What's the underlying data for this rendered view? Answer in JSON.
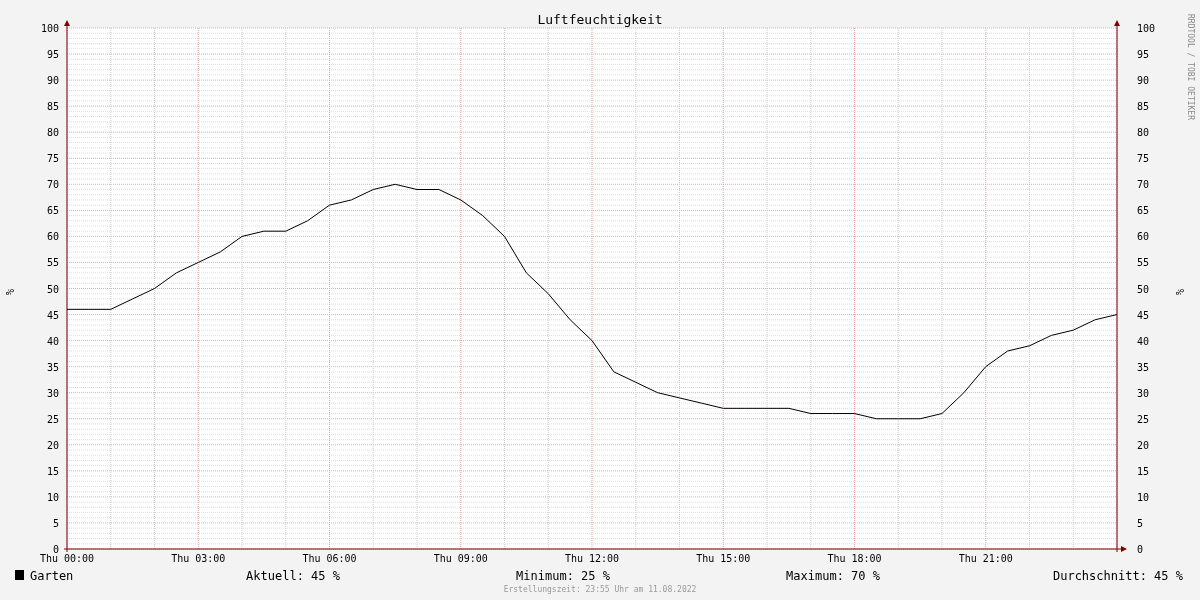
{
  "chart": {
    "watermark": "RRDTOOL / TOBI OETIKER",
    "chart_data": {
      "type": "line",
      "title": "Luftfeuchtigkeit",
      "ylabel": "%",
      "categories": [
        "Thu 00:00",
        null,
        null,
        null,
        null,
        null,
        "Thu 03:00",
        null,
        null,
        null,
        null,
        null,
        "Thu 06:00",
        null,
        null,
        null,
        null,
        null,
        "Thu 09:00",
        null,
        null,
        null,
        null,
        null,
        "Thu 12:00",
        null,
        null,
        null,
        null,
        null,
        "Thu 15:00",
        null,
        null,
        null,
        null,
        null,
        "Thu 18:00",
        null,
        null,
        null,
        null,
        null,
        "Thu 21:00",
        null,
        null,
        null,
        null,
        null,
        null
      ],
      "series": [
        {
          "name": "Garten",
          "color": "#000000",
          "values": [
            46,
            46,
            46,
            48,
            50,
            53,
            55,
            57,
            60,
            61,
            61,
            63,
            66,
            67,
            69,
            70,
            69,
            69,
            67,
            64,
            60,
            53,
            49,
            44,
            40,
            34,
            32,
            30,
            29,
            28,
            27,
            27,
            27,
            27,
            26,
            26,
            26,
            25,
            25,
            25,
            26,
            30,
            35,
            38,
            39,
            41,
            42,
            44,
            45
          ]
        }
      ],
      "ylim": [
        0,
        100
      ],
      "grid": true,
      "yticks": [
        0,
        5,
        10,
        15,
        20,
        25,
        30,
        35,
        40,
        45,
        50,
        55,
        60,
        65,
        70,
        75,
        80,
        85,
        90,
        95,
        100
      ]
    },
    "right_axis": {
      "label": "%",
      "ticks": [
        "100",
        "95",
        "90",
        "85",
        "80",
        "75",
        "70",
        "65",
        "60",
        "55",
        "50",
        "45",
        "40",
        "35",
        "30",
        "25",
        "20",
        "15",
        "10",
        "5",
        "0"
      ]
    }
  },
  "legend": {
    "stats": [
      {
        "label": "Aktuell:",
        "value": "45 %"
      },
      {
        "label": "Minimum:",
        "value": "25 %"
      },
      {
        "label": "Maximum:",
        "value": "70 %"
      },
      {
        "label": "Durchschnitt:",
        "value": "45 %"
      }
    ]
  },
  "footer": "Erstellungszeit: 23:55 Uhr am 11.08.2022"
}
